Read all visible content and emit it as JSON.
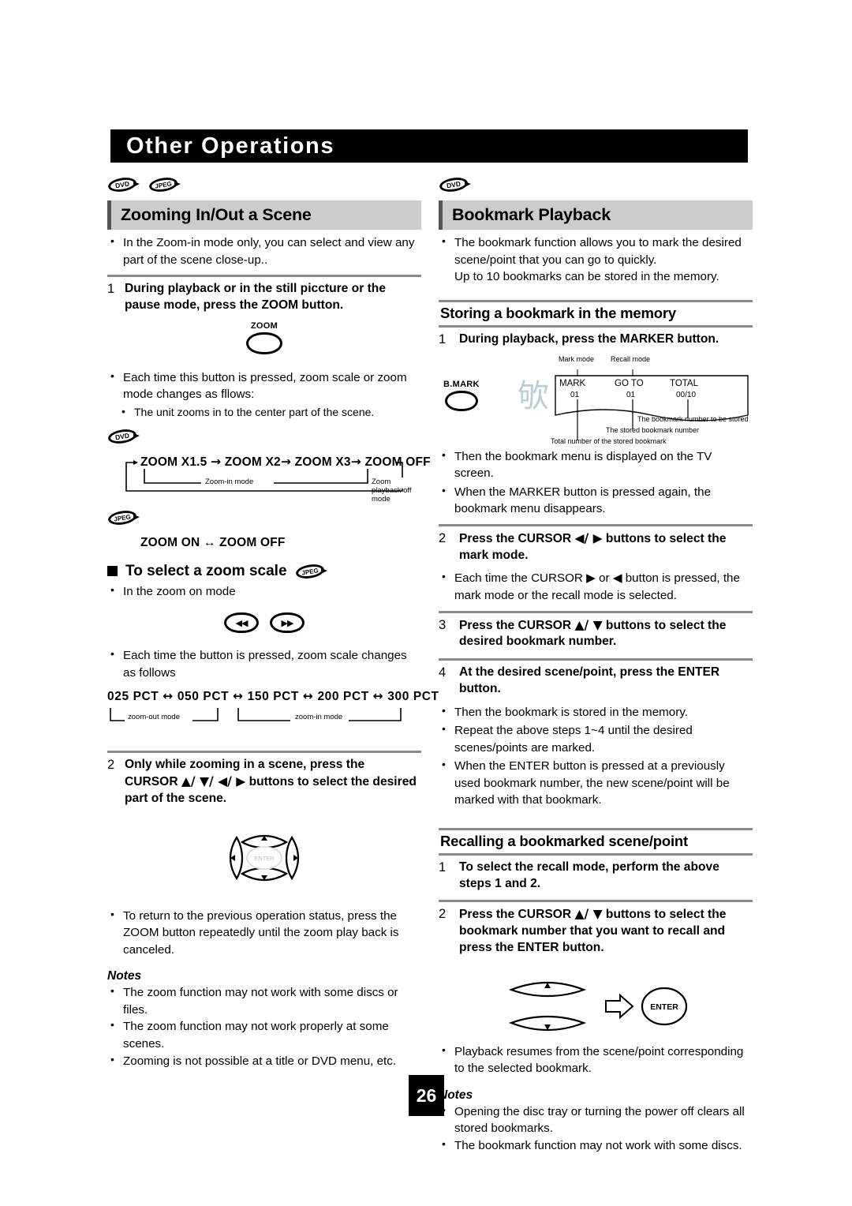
{
  "page": {
    "title": "Other Operations",
    "page_number": "26"
  },
  "left_column": {
    "media_icons": [
      "DVD",
      "JPEG"
    ],
    "section_title": "Zooming In/Out a Scene",
    "intro_bullets": [
      "In the Zoom-in mode only, you can select and view any part of the scene close-up.."
    ],
    "step1": {
      "number": "1",
      "text": "During playback or in the still piccture or the pause mode, press the ZOOM button."
    },
    "zoom_button_label": "ZOOM",
    "after_step1_bullets": [
      "Each time this button is pressed, zoom scale or zoom mode changes as fllows:"
    ],
    "after_step1_subbullets": [
      "The unit zooms in to the center part of the scene."
    ],
    "dvd_flow": {
      "media_icon": "DVD",
      "items": [
        "ZOOM X1.5",
        "ZOOM X2",
        "ZOOM X3",
        "ZOOM OFF"
      ],
      "separator": "→",
      "label_left": "Zoom-in mode",
      "label_right": "Zoom playback off mode"
    },
    "jpeg_flow": {
      "media_icon": "JPEG",
      "text": "ZOOM  ON ↔ ZOOM  OFF"
    },
    "zoom_scale_heading": "To select a zoom scale",
    "zoom_scale_heading_icon": "JPEG",
    "zoom_scale_bullets": [
      "In the zoom on mode"
    ],
    "skip_buttons": [
      "◀◀",
      "▶▶"
    ],
    "zoom_scale_bullets2": [
      "Each time the button is pressed, zoom scale changes as follows"
    ],
    "pct_flow": {
      "items": [
        "025  PCT",
        "050  PCT",
        "150  PCT",
        "200  PCT",
        "300  PCT"
      ],
      "separator": "↔",
      "label_left": "zoom-out mode",
      "label_right": "zoom-in mode"
    },
    "step2": {
      "number": "2",
      "text_a": "Only while zooming in a scene, press the",
      "text_b": "CURSOR",
      "cursor_glyphs": "▲/ ▼/ ◀/ ▶",
      "text_c": "buttons to select the desired",
      "text_d": "part of the scene."
    },
    "cursor_pad_center_label": "ENTER",
    "after_step2_bullets": [
      "To return to the previous operation status, press the ZOOM button repeatedly until the zoom play back is canceled."
    ],
    "notes_title": "Notes",
    "notes": [
      "The zoom function may not work with some discs or files.",
      "The zoom function may not work properly at some scenes.",
      "Zooming is not possible at a title or DVD menu, etc."
    ]
  },
  "right_column": {
    "media_icons": [
      "DVD"
    ],
    "section_title": "Bookmark Playback",
    "intro_bullets": [
      "The bookmark function allows you to mark the desired scene/point that you can go to quickly.",
      "Up to 10 bookmarks can be stored in the memory."
    ],
    "storing_heading": "Storing a bookmark in the memory",
    "step1": {
      "number": "1",
      "text": "During playback, press the MARKER button."
    },
    "marker_button_label": "B.MARK",
    "deco_character": "欨",
    "osd_diagram": {
      "callout_mark_mode": "Mark mode",
      "callout_recall_mode": "Recall mode",
      "columns": [
        {
          "header": "MARK",
          "value": "01"
        },
        {
          "header": "GO TO",
          "value": "01"
        },
        {
          "header": "TOTAL",
          "value": "00/10"
        }
      ],
      "note_top": "The bookmark number to be stored",
      "note_mid": "The stored bookmark number",
      "note_bottom": "Total number of the stored bookmark"
    },
    "after_step1_bullets": [
      "Then the bookmark menu is displayed on the TV screen.",
      "When the MARKER button is pressed again, the bookmark menu disappears."
    ],
    "step2": {
      "number": "2",
      "text_a": "Press the CURSOR",
      "cursor_glyphs": "◀/ ▶",
      "text_b": "buttons to select the mark mode."
    },
    "after_step2_bullets_a": "Each time the CURSOR",
    "after_step2_glyph_1": "▶",
    "after_step2_bullets_b": "or",
    "after_step2_glyph_2": "◀",
    "after_step2_bullets_c": "button is pressed, the mark mode or the recall mode is selected.",
    "step3": {
      "number": "3",
      "text_a": "Press the CURSOR",
      "cursor_glyphs": "▲/ ▼",
      "text_b": "buttons to select the desired bookmark number."
    },
    "step4": {
      "number": "4",
      "text": "At the desired scene/point, press the ENTER button."
    },
    "after_step4_bullets": [
      "Then the bookmark is stored in the memory.",
      "Repeat the above steps 1~4 until the desired scenes/points are marked.",
      "When the ENTER button is pressed at a previously used bookmark number, the new scene/point will be marked with that bookmark."
    ],
    "recalling_heading": "Recalling a bookmarked scene/point",
    "recall_step1": {
      "number": "1",
      "text": "To select the recall mode, perform the above steps 1 and 2."
    },
    "recall_step2": {
      "number": "2",
      "text_a": "Press the CURSOR",
      "cursor_glyphs": "▲/ ▼",
      "text_b": "buttons to select the bookmark number that you want to recall and press the ENTER button."
    },
    "recall_enter_label": "ENTER",
    "after_recall_bullets": [
      "Playback resumes from the scene/point corresponding to the selected bookmark."
    ],
    "notes_title": "Notes",
    "notes": [
      "Opening the disc tray or turning the power off clears all stored bookmarks.",
      "The bookmark function may not work with some discs."
    ]
  },
  "colors": {
    "banner_bg": "#000000",
    "section_header_bg": "#cccccc",
    "rule": "#8a8a8a",
    "deco_char": "#b9cfd4"
  }
}
